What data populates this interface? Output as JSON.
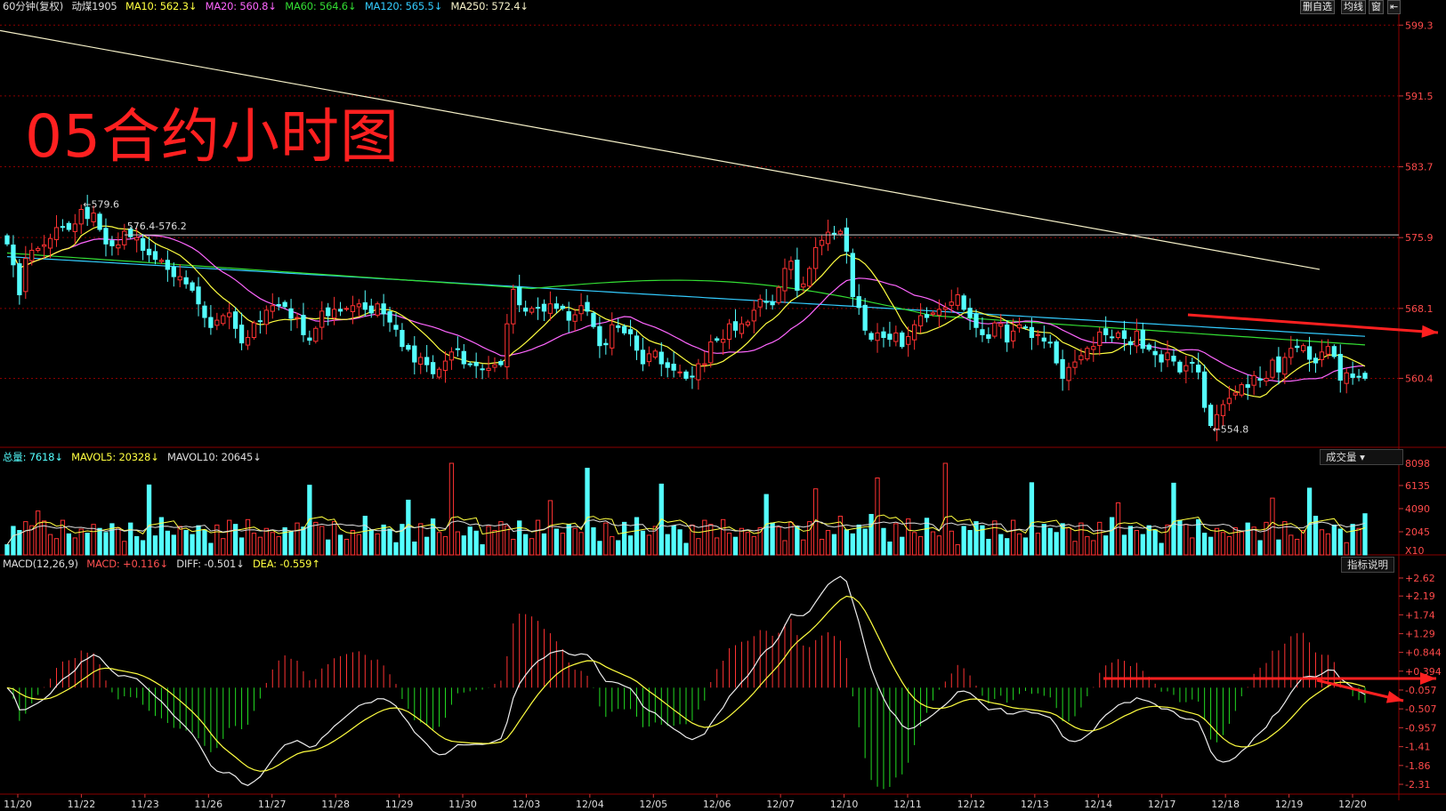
{
  "header": {
    "period": "60分钟(复权)",
    "symbol": "动煤1905",
    "ma": [
      {
        "label": "MA10: 562.3↓",
        "color": "#ffff40"
      },
      {
        "label": "MA20: 560.8↓",
        "color": "#ff66ff"
      },
      {
        "label": "MA60: 564.6↓",
        "color": "#33dd33"
      },
      {
        "label": "MA120: 565.5↓",
        "color": "#33ccff"
      },
      {
        "label": "MA250: 572.4↓",
        "color": "#f5f0c8"
      }
    ]
  },
  "toolbar": {
    "del_fav": "删自选",
    "avg_line": "均线",
    "window": "窗",
    "pin_icon": "pin-icon"
  },
  "annotation_title": "05合约小时图",
  "volume": {
    "total": "总量: 7618↓",
    "mavol5": "MAVOL5: 20328↓",
    "mavol10": "MAVOL10: 20645↓",
    "selector": "成交量 ▾",
    "ticks": [
      "8098",
      "6135",
      "4090",
      "2045"
    ],
    "multiplier": "X10"
  },
  "macd": {
    "label": "MACD(12,26,9)",
    "macd": "MACD: +0.116↓",
    "diff": "DIFF: -0.501↓",
    "dea": "DEA: -0.559↑",
    "help": "指标说明",
    "ticks": [
      "+2.62",
      "+2.19",
      "+1.74",
      "+1.29",
      "+0.844",
      "+0.394",
      "-0.057",
      "-0.507",
      "-0.957",
      "-1.41",
      "-1.86",
      "-2.31"
    ]
  },
  "price_axis": [
    "599.3",
    "591.5",
    "583.7",
    "575.9",
    "568.1",
    "560.4"
  ],
  "price_marks": {
    "high": "579.6",
    "low": "554.8",
    "range": "576.4-576.2"
  },
  "dates": [
    "11/20",
    "11/22",
    "11/23",
    "11/26",
    "11/27",
    "11/28",
    "11/29",
    "11/30",
    "12/03",
    "12/04",
    "12/05",
    "12/06",
    "12/07",
    "12/10",
    "12/11",
    "12/12",
    "12/13",
    "12/14",
    "12/17",
    "12/18",
    "12/19",
    "12/20"
  ],
  "colors": {
    "up": "#ff3232",
    "down": "#54ffff",
    "grid": "#8b0000",
    "annotation": "#ff2020"
  },
  "chart_data": {
    "type": "candlestick",
    "price_range": [
      553.0,
      600.5
    ],
    "closes": [
      575.2,
      572.9,
      569.6,
      573.6,
      574.5,
      574.7,
      575.1,
      575.8,
      577.0,
      577.1,
      576.8,
      577.4,
      579.0,
      578.0,
      578.6,
      576.8,
      575.2,
      575.0,
      575.1,
      576.6,
      576.0,
      575.9,
      574.5,
      574.0,
      573.5,
      573.4,
      572.4,
      571.6,
      571.6,
      570.8,
      570.1,
      568.6,
      567.1,
      566.0,
      566.8,
      567.3,
      567.6,
      565.9,
      564.3,
      564.9,
      566.5,
      566.7,
      567.9,
      568.4,
      568.4,
      568.3,
      567.0,
      567.1,
      565.2,
      564.6,
      565.9,
      567.8,
      567.3,
      568.0,
      567.8,
      568.1,
      568.4,
      568.6,
      568.0,
      567.6,
      568.6,
      567.5,
      566.6,
      565.8,
      563.9,
      563.6,
      562.2,
      562.7,
      561.9,
      560.9,
      561.4,
      562.3,
      563.3,
      563.6,
      562.0,
      561.9,
      561.8,
      561.4,
      561.5,
      561.9,
      561.9,
      566.4,
      570.2,
      568.5,
      567.8,
      568.1,
      568.2,
      567.8,
      568.6,
      568.1,
      568.1,
      566.8,
      567.4,
      568.4,
      567.8,
      566.1,
      564.0,
      564.1,
      566.3,
      566.0,
      565.4,
      565.3,
      563.5,
      562.0,
      563.1,
      563.4,
      562.0,
      561.6,
      561.3,
      561.1,
      560.4,
      560.6,
      562.0,
      562.0,
      564.4,
      564.6,
      564.7,
      566.4,
      565.7,
      566.4,
      566.6,
      567.9,
      569.1,
      568.8,
      568.5,
      570.4,
      572.5,
      573.3,
      570.1,
      570.8,
      572.5,
      574.8,
      575.6,
      576.5,
      576.2,
      576.6,
      574.4,
      569.4,
      568.2,
      565.7,
      564.7,
      565.4,
      564.9,
      564.7,
      565.4,
      563.9,
      565.0,
      566.3,
      567.3,
      567.1,
      567.6,
      568.0,
      568.2,
      568.8,
      569.6,
      568.0,
      567.1,
      566.0,
      565.2,
      564.8,
      566.5,
      566.4,
      564.4,
      565.6,
      566.3,
      566.0,
      564.9,
      565.2,
      564.5,
      564.3,
      562.1,
      560.4,
      561.6,
      562.2,
      562.9,
      563.7,
      563.9,
      565.5,
      565.2,
      564.9,
      565.4,
      564.8,
      564.1,
      565.6,
      563.7,
      563.6,
      563.0,
      562.2,
      563.2,
      562.3,
      561.1,
      561.8,
      562.1,
      561.1,
      557.2,
      555.2,
      556.4,
      557.5,
      558.2,
      558.8,
      559.7,
      559.4,
      560.7,
      560.2,
      560.4,
      562.4,
      561.1,
      562.7,
      563.7,
      563.8,
      564.0,
      562.5,
      562.1,
      563.3,
      563.9,
      562.8,
      560.2,
      561.0,
      560.5,
      560.6,
      560.4
    ],
    "ma250": {
      "x": [
        0,
        1483
      ],
      "y": [
        598.7,
        572.4
      ]
    },
    "x_axis": "time (60-minute bars)",
    "y_axis": "price"
  }
}
